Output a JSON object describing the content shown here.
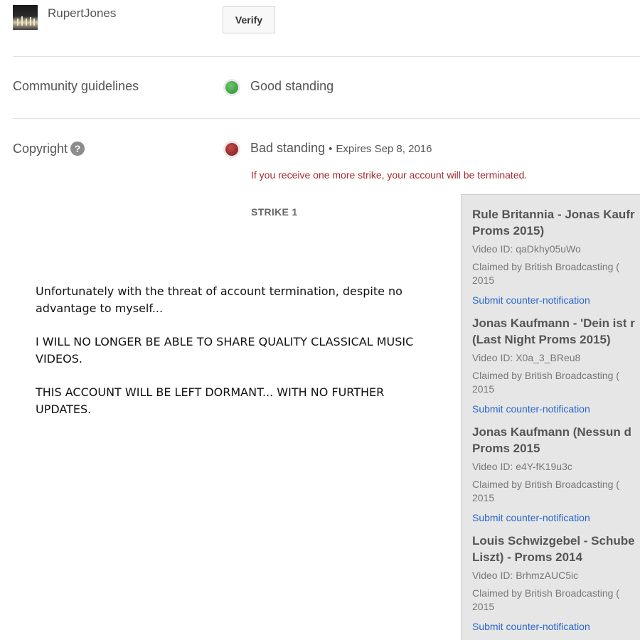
{
  "account": {
    "username": "RupertJones",
    "verify_label": "Verify"
  },
  "community": {
    "label": "Community guidelines",
    "status": "Good standing",
    "status_color": "#3d9a3d"
  },
  "copyright": {
    "label": "Copyright",
    "help_icon": "question-mark-icon",
    "status": "Bad standing",
    "separator": "•",
    "expires": "Expires Sep 8, 2016",
    "status_color": "#8b2020",
    "warning": "If you receive one more strike, your account will be terminated.",
    "strike_label": "STRIKE 1"
  },
  "message": {
    "paragraphs": [
      "Unfortunately with the threat of account termination, despite no advantage to myself...",
      "I WILL NO LONGER BE ABLE TO SHARE QUALITY CLASSICAL MUSIC VIDEOS.",
      "THIS ACCOUNT WILL BE LEFT DORMANT... WITH NO FURTHER UPDATES."
    ]
  },
  "claims": [
    {
      "title": "Rule Britannia - Jonas Kaufr\nProms 2015)",
      "video_id": "Video ID: qaDkhy05uWo",
      "claimed_by": "Claimed by British Broadcasting (\n2015",
      "link": "Submit counter-notification"
    },
    {
      "title": "Jonas Kaufmann - 'Dein ist r\n(Last Night Proms 2015)",
      "video_id": "Video ID: X0a_3_BReu8",
      "claimed_by": "Claimed by British Broadcasting (\n2015",
      "link": "Submit counter-notification"
    },
    {
      "title": "Jonas Kaufmann (Nessun d\nProms 2015",
      "video_id": "Video ID: e4Y-fK19u3c",
      "claimed_by": "Claimed by British Broadcasting (\n2015",
      "link": "Submit counter-notification"
    },
    {
      "title": "Louis Schwizgebel - Schube\nLiszt) - Proms 2014",
      "video_id": "Video ID: BrhmzAUC5ic",
      "claimed_by": "Claimed by British Broadcasting (\n2015",
      "link": "Submit counter-notification"
    }
  ]
}
